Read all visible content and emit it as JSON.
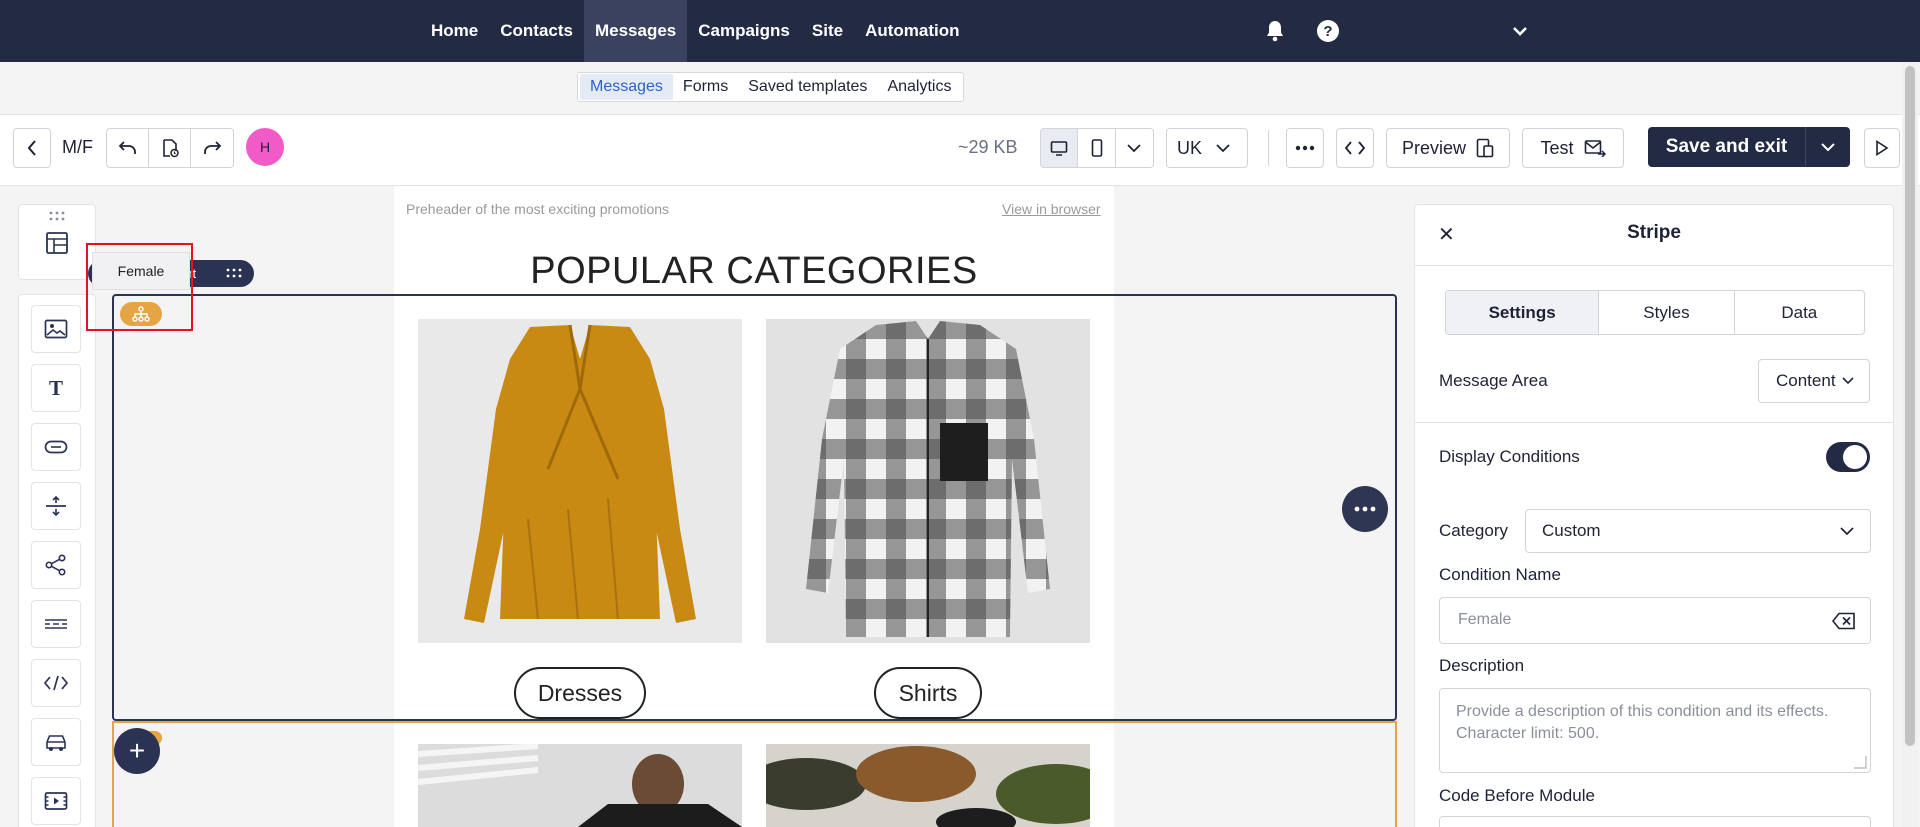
{
  "nav": {
    "items": [
      "Home",
      "Contacts",
      "Messages",
      "Campaigns",
      "Site",
      "Automation"
    ],
    "active_index": 2,
    "icons": [
      "bell-icon",
      "help-icon",
      "chevron-down-icon"
    ]
  },
  "subnav": {
    "items": [
      "Messages",
      "Forms",
      "Saved templates",
      "Analytics"
    ],
    "active_index": 0
  },
  "toolbar": {
    "back_icon": "chevron-left-icon",
    "template_name": "M/F",
    "undo_icon": "undo-icon",
    "history_icon": "history-icon",
    "redo_icon": "redo-icon",
    "avatar_initial": "H",
    "avatar_color": "#f05bc8",
    "size": "~29 KB",
    "device_icons": [
      "desktop-icon",
      "mobile-icon",
      "chevron-down-icon"
    ],
    "language": "UK",
    "more_icon": "more-horizontal-icon",
    "code_icon": "code-icon",
    "preview_label": "Preview",
    "test_label": "Test",
    "save_label": "Save and exit",
    "run_icon": "play-icon"
  },
  "left_sidebar": {
    "top_icon": "layout-icon",
    "tools": [
      "image-icon",
      "text-icon",
      "button-icon",
      "spacer-icon",
      "social-icon",
      "divider-icon",
      "html-icon",
      "car-icon",
      "video-icon"
    ]
  },
  "canvas": {
    "preheader": "Preheader of the most exciting promotions",
    "view_in_browser": "View in browser",
    "heading": "POPULAR CATEGORIES",
    "buttons": [
      "Dresses",
      "Shirts"
    ],
    "stripe_tag": "ent",
    "tooltip": "Female"
  },
  "panel": {
    "title": "Stripe",
    "tabs": [
      "Settings",
      "Styles",
      "Data"
    ],
    "active_tab": 0,
    "message_area_label": "Message Area",
    "message_area_value": "Content",
    "display_conditions_label": "Display Conditions",
    "display_conditions_on": true,
    "category_label": "Category",
    "category_value": "Custom",
    "condition_name_label": "Condition Name",
    "condition_name_value": "Female",
    "description_label": "Description",
    "description_placeholder": "Provide a description of this condition and its effects. Character limit: 500.",
    "code_before_label": "Code Before Module"
  },
  "colors": {
    "nav_bg": "#222a44",
    "accent_blue": "#2d63c8",
    "stripe_selected": "#2a3352",
    "condition_orange": "#e6a545",
    "highlight_red": "#e8121b"
  }
}
